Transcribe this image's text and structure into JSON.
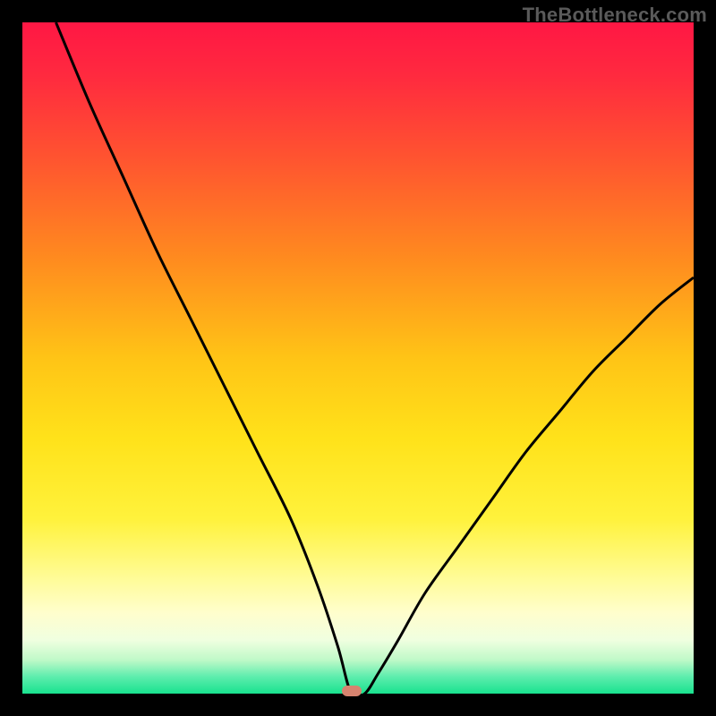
{
  "attribution": "TheBottleneck.com",
  "colors": {
    "gradient_stops": [
      {
        "offset": 0.0,
        "color": "#ff1744"
      },
      {
        "offset": 0.08,
        "color": "#ff2a3f"
      },
      {
        "offset": 0.2,
        "color": "#ff5330"
      },
      {
        "offset": 0.35,
        "color": "#ff8a1f"
      },
      {
        "offset": 0.5,
        "color": "#ffc416"
      },
      {
        "offset": 0.62,
        "color": "#ffe21a"
      },
      {
        "offset": 0.74,
        "color": "#fff23c"
      },
      {
        "offset": 0.82,
        "color": "#fffb8f"
      },
      {
        "offset": 0.88,
        "color": "#fffecd"
      },
      {
        "offset": 0.92,
        "color": "#f0ffe0"
      },
      {
        "offset": 0.95,
        "color": "#bff9c8"
      },
      {
        "offset": 0.975,
        "color": "#5dedad"
      },
      {
        "offset": 1.0,
        "color": "#19e28f"
      }
    ],
    "curve_stroke": "#000000",
    "marker_fill": "#d6836f",
    "frame_bg": "#000000"
  },
  "chart_data": {
    "type": "line",
    "title": "",
    "xlabel": "",
    "ylabel": "",
    "xlim": [
      0,
      100
    ],
    "ylim": [
      0,
      100
    ],
    "grid": false,
    "legend": false,
    "minimum_x": 49,
    "series": [
      {
        "name": "bottleneck-curve",
        "x": [
          5,
          10,
          15,
          20,
          25,
          30,
          35,
          40,
          44,
          47,
          49,
          51,
          53,
          56,
          60,
          65,
          70,
          75,
          80,
          85,
          90,
          95,
          100
        ],
        "values": [
          100,
          88,
          77,
          66,
          56,
          46,
          36,
          26,
          16,
          7,
          0,
          0,
          3,
          8,
          15,
          22,
          29,
          36,
          42,
          48,
          53,
          58,
          62
        ]
      }
    ]
  }
}
